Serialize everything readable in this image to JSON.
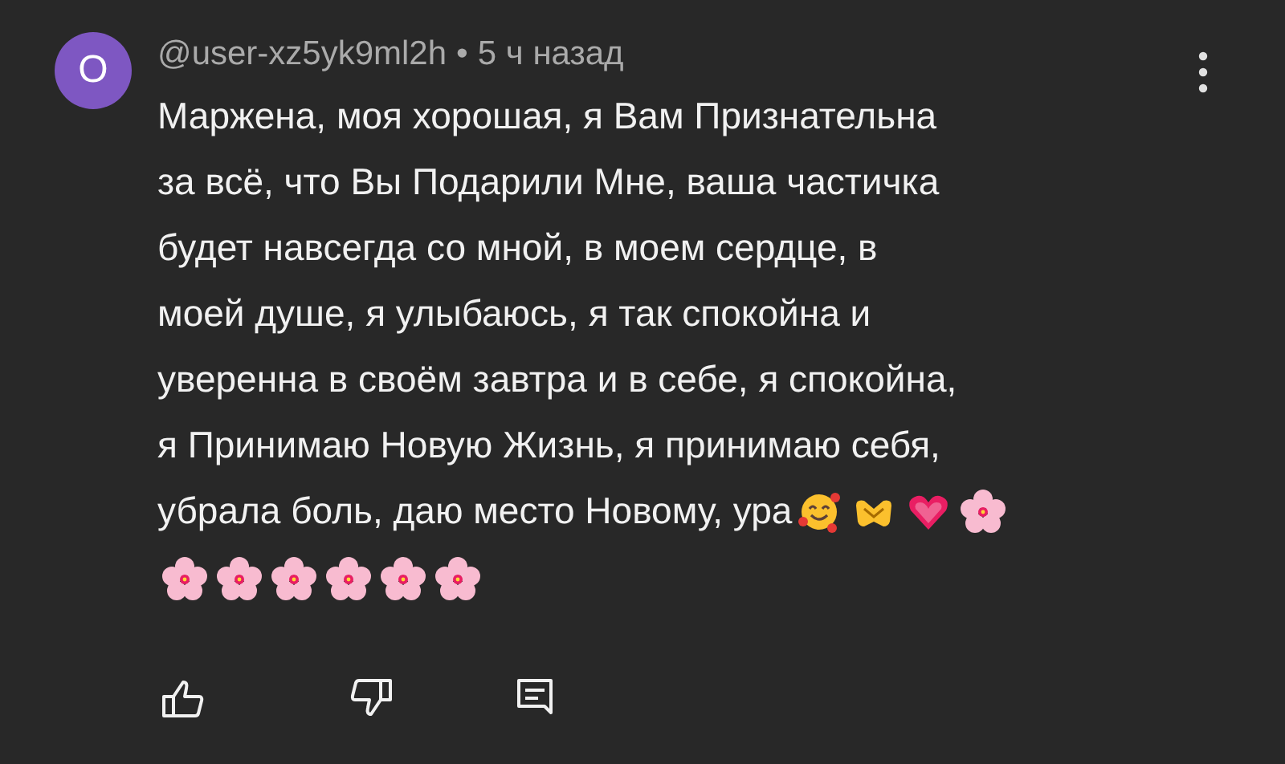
{
  "comment": {
    "avatar_letter": "O",
    "author": "@user-xz5yk9ml2h",
    "separator": "•",
    "time": "5 ч назад",
    "text_lines": [
      "Маржена, моя хорошая, я Вам Признательна",
      "за всё, что Вы Подарили Мне, ваша частичка",
      "будет навсегда со мной, в моем сердце, в",
      "моей душе, я улыбаюсь, я так спокойна и",
      "уверенна в своём завтра и в себе, я спокойна,",
      "я Принимаю Новую Жизнь, я принимаю себя,",
      "убрала боль, даю место Новому, ура"
    ],
    "emojis_after_text": [
      {
        "kind": "smiling"
      },
      {
        "kind": "heart_hands"
      },
      {
        "kind": "heart"
      },
      {
        "kind": "flower"
      }
    ],
    "emojis_next_line": [
      {
        "kind": "flower"
      },
      {
        "kind": "flower"
      },
      {
        "kind": "flower"
      },
      {
        "kind": "flower"
      },
      {
        "kind": "flower"
      },
      {
        "kind": "flower"
      }
    ]
  }
}
